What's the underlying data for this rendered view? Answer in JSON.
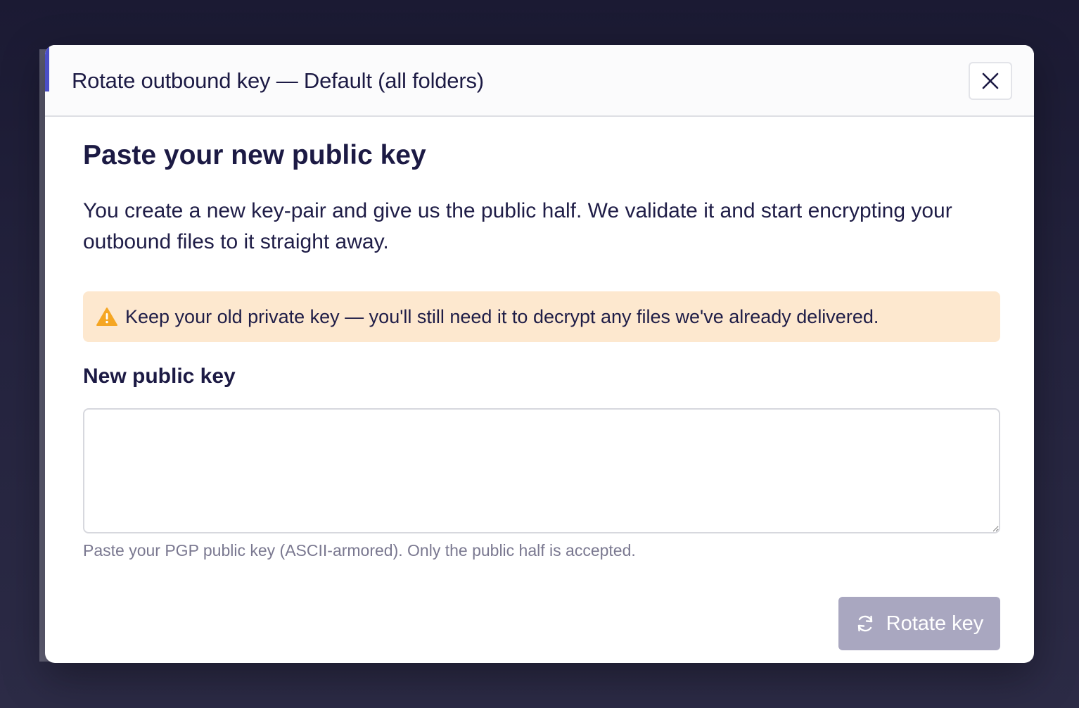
{
  "modal": {
    "title": "Rotate outbound key — Default (all folders)",
    "close_icon": "close-icon"
  },
  "content": {
    "heading": "Paste your new public key",
    "description": "You create a new key-pair and give us the public half. We validate it and start encrypting your outbound files to it straight away.",
    "warning": {
      "icon": "warning-icon",
      "text": "Keep your old private key — you'll still need it to decrypt any files we've already delivered."
    },
    "field": {
      "label": "New public key",
      "value": "",
      "placeholder": "",
      "helper": "Paste your PGP public key (ASCII-armored). Only the public half is accepted."
    },
    "rotate_button": {
      "label": "Rotate key",
      "icon": "refresh-icon",
      "disabled": true
    }
  },
  "colors": {
    "accent": "#4a4ec6",
    "text": "#1c1a44",
    "warning_bg": "#fde8cf",
    "warning_icon": "#f5a623",
    "button_disabled": "#a9a7c0",
    "helper": "#7a7890"
  }
}
